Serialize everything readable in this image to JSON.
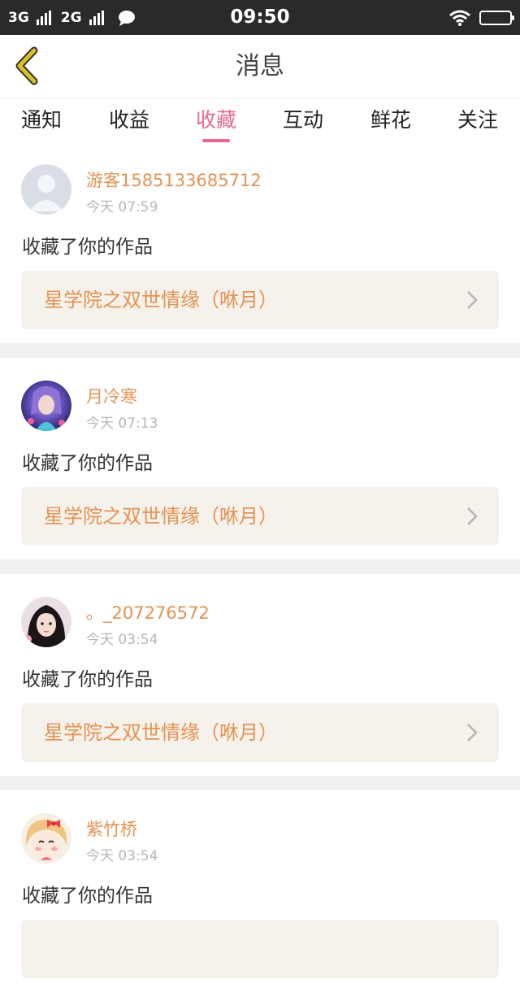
{
  "status_bar": {
    "network1": "3G",
    "network2": "2G",
    "time": "09:50"
  },
  "header": {
    "title": "消息"
  },
  "tabs": [
    {
      "label": "通知",
      "active": false
    },
    {
      "label": "收益",
      "active": false
    },
    {
      "label": "收藏",
      "active": true
    },
    {
      "label": "互动",
      "active": false
    },
    {
      "label": "鲜花",
      "active": false
    },
    {
      "label": "关注",
      "active": false
    }
  ],
  "messages": [
    {
      "user": "游客1585133685712",
      "time": "今天 07:59",
      "action": "收藏了你的作品",
      "work": "星学院之双世情缘（咻月）"
    },
    {
      "user": "月冷寒",
      "time": "今天 07:13",
      "action": "收藏了你的作品",
      "work": "星学院之双世情缘（咻月）"
    },
    {
      "user": "。_207276572",
      "time": "今天 03:54",
      "action": "收藏了你的作品",
      "work": "星学院之双世情缘（咻月）"
    },
    {
      "user": "紫竹桥",
      "time": "今天 03:54",
      "action": "收藏了你的作品",
      "work": ""
    }
  ],
  "colors": {
    "accent": "#e56a95",
    "username": "#e69254",
    "back_icon": "#d9c025",
    "work_bg": "#f4f2ea"
  }
}
